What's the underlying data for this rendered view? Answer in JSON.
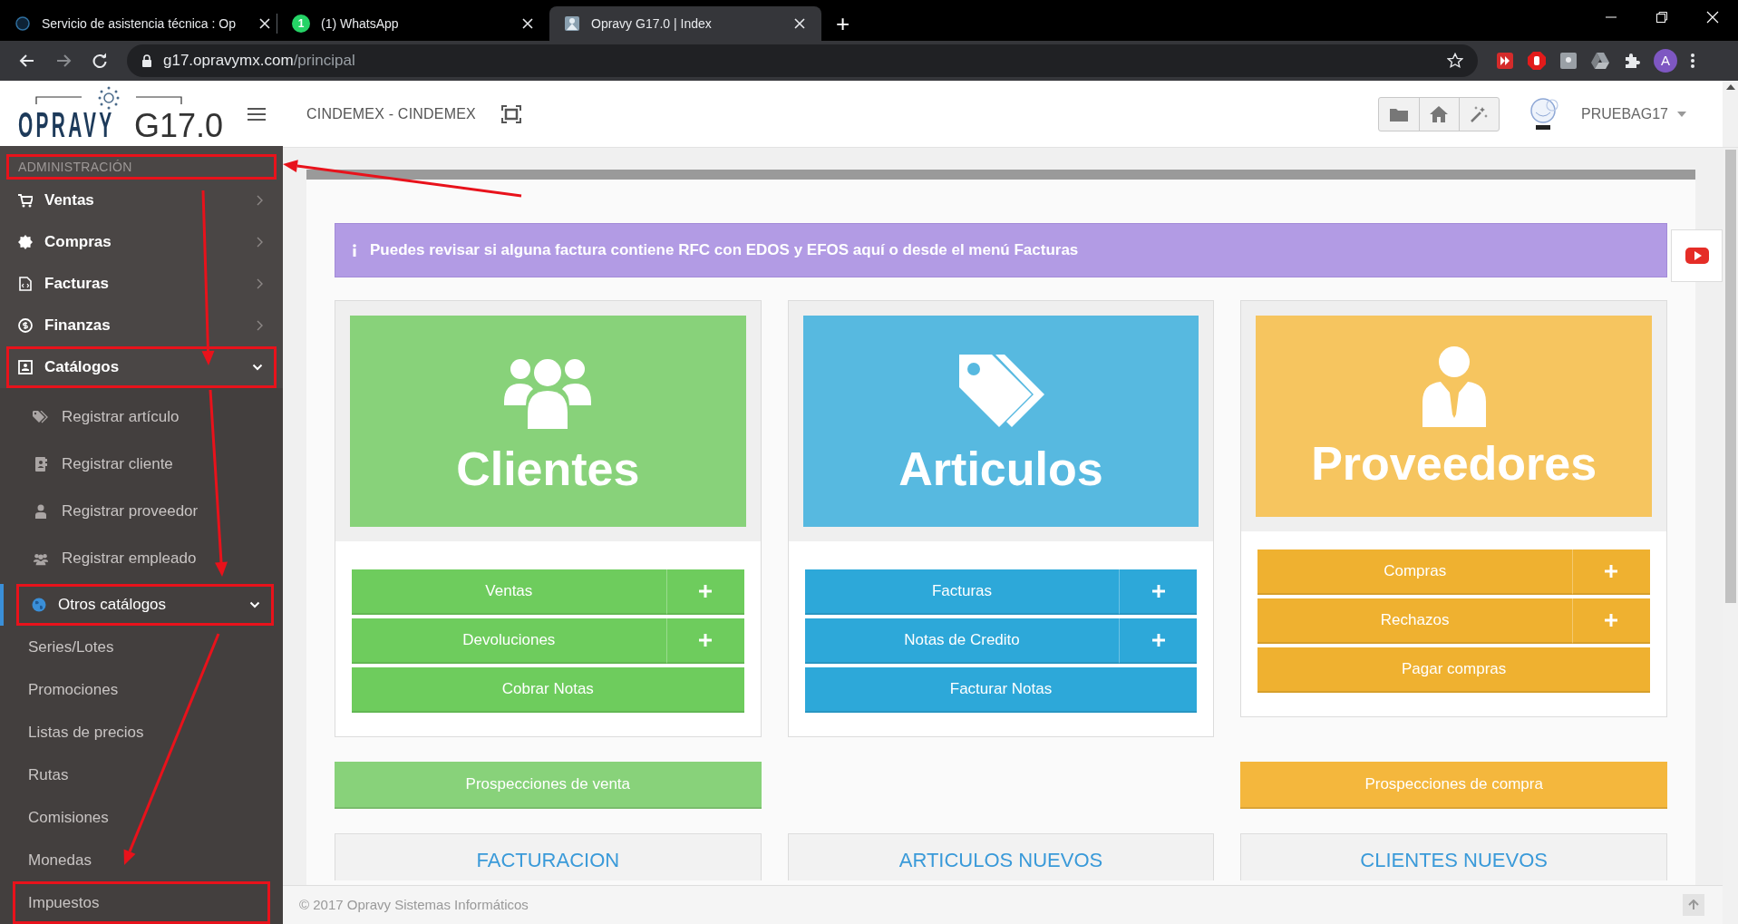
{
  "browser": {
    "tabs": [
      {
        "title": "Servicio de asistencia técnica : Op",
        "selected": false
      },
      {
        "title": "(1) WhatsApp",
        "selected": false,
        "badge": "1"
      },
      {
        "title": "Opravy G17.0 | Index",
        "selected": true
      }
    ],
    "new_tab": "+",
    "address": {
      "host": "g17.opravymx.com",
      "path": "/principal"
    },
    "profile": "A"
  },
  "header": {
    "logo_left": "OPRAVY",
    "logo_right": "G17.0",
    "company": "CINDEMEX - CINDEMEX",
    "user": "PRUEBAG17"
  },
  "sidebar": {
    "section": {
      "label": "ADMINISTRACIÓN",
      "highlighted": true
    },
    "items": [
      {
        "label": "Ventas",
        "expanded": false,
        "highlighted": false
      },
      {
        "label": "Compras",
        "expanded": false,
        "highlighted": false
      },
      {
        "label": "Facturas",
        "expanded": false,
        "highlighted": false
      },
      {
        "label": "Finanzas",
        "expanded": false,
        "highlighted": false
      },
      {
        "label": "Catálogos",
        "expanded": true,
        "highlighted": true,
        "children": [
          {
            "label": "Registrar artículo",
            "selected": false,
            "highlighted": false
          },
          {
            "label": "Registrar cliente",
            "selected": false,
            "highlighted": false
          },
          {
            "label": "Registrar proveedor",
            "selected": false,
            "highlighted": false
          },
          {
            "label": "Registrar empleado",
            "selected": false,
            "highlighted": false
          },
          {
            "label": "Otros catálogos",
            "selected": true,
            "expanded": true,
            "highlighted": true,
            "children": [
              {
                "label": "Series/Lotes",
                "highlighted": false
              },
              {
                "label": "Promociones",
                "highlighted": false
              },
              {
                "label": "Listas de precios",
                "highlighted": false
              },
              {
                "label": "Rutas",
                "highlighted": false
              },
              {
                "label": "Comisiones",
                "highlighted": false
              },
              {
                "label": "Monedas",
                "highlighted": false
              },
              {
                "label": "Impuestos",
                "highlighted": true
              }
            ]
          }
        ]
      }
    ]
  },
  "alert": {
    "text": "Puedes revisar si alguna factura contiene RFC con EDOS y EFOS aquí o desde el menú Facturas"
  },
  "cards": [
    {
      "title": "Clientes",
      "color": "#88d27a",
      "buttons": [
        {
          "label": "Ventas",
          "add": true
        },
        {
          "label": "Devoluciones",
          "add": true
        },
        {
          "label": "Cobrar Notas",
          "add": false
        }
      ]
    },
    {
      "title": "Articulos",
      "color": "#57b9e0",
      "buttons": [
        {
          "label": "Facturas",
          "add": true
        },
        {
          "label": "Notas de Credito",
          "add": true
        },
        {
          "label": "Facturar Notas",
          "add": false
        }
      ]
    },
    {
      "title": "Proveedores",
      "color": "#f6c55f",
      "buttons": [
        {
          "label": "Compras",
          "add": true
        },
        {
          "label": "Rechazos",
          "add": true
        },
        {
          "label": "Pagar compras",
          "add": false
        }
      ]
    }
  ],
  "prospects": [
    {
      "label": "Prospecciones de venta",
      "color": "#88d27a"
    },
    {
      "label": "Prospecciones de compra",
      "color": "#f4b73d"
    }
  ],
  "stats": [
    "FACTURACION",
    "ARTICULOS NUEVOS",
    "CLIENTES NUEVOS"
  ],
  "footer": "© 2017 Opravy Sistemas Informáticos"
}
